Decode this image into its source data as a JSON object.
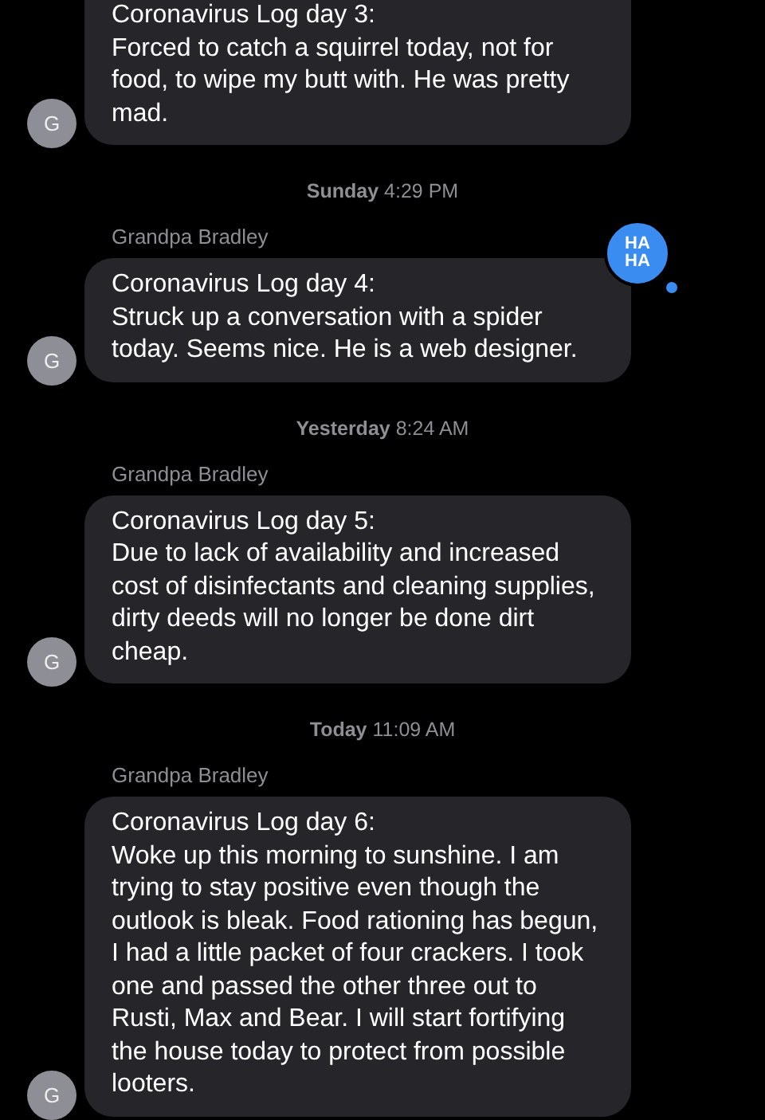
{
  "messages": [
    {
      "kind": "message",
      "avatar": "G",
      "lines": [
        "Coronavirus Log day 3:",
        "Forced to catch a squirrel today, not for food, to wipe my butt with. He was pretty mad."
      ]
    },
    {
      "kind": "timestamp",
      "day": "Sunday",
      "time": "4:29 PM"
    },
    {
      "kind": "message",
      "sender": "Grandpa Bradley",
      "avatar": "G",
      "lines": [
        "Coronavirus Log day 4:",
        "Struck up a conversation with a spider today. Seems nice. He is a web designer."
      ],
      "reaction": [
        "HA",
        "HA"
      ]
    },
    {
      "kind": "timestamp",
      "day": "Yesterday",
      "time": "8:24 AM"
    },
    {
      "kind": "message",
      "sender": "Grandpa Bradley",
      "avatar": "G",
      "lines": [
        "Coronavirus Log day 5:",
        "Due to lack of availability and increased cost of disinfectants and cleaning supplies, dirty deeds will no longer be done dirt cheap."
      ]
    },
    {
      "kind": "timestamp",
      "day": "Today",
      "time": "11:09 AM"
    },
    {
      "kind": "message",
      "sender": "Grandpa Bradley",
      "avatar": "G",
      "lines": [
        "Coronavirus Log day 6:",
        "Woke up this morning to sunshine. I am trying to stay positive even though the outlook is bleak. Food rationing has begun, I had a little packet of four crackers. I took one and passed the other three out to Rusti, Max and Bear. I will start fortifying the house today to protect from possible looters."
      ]
    }
  ]
}
